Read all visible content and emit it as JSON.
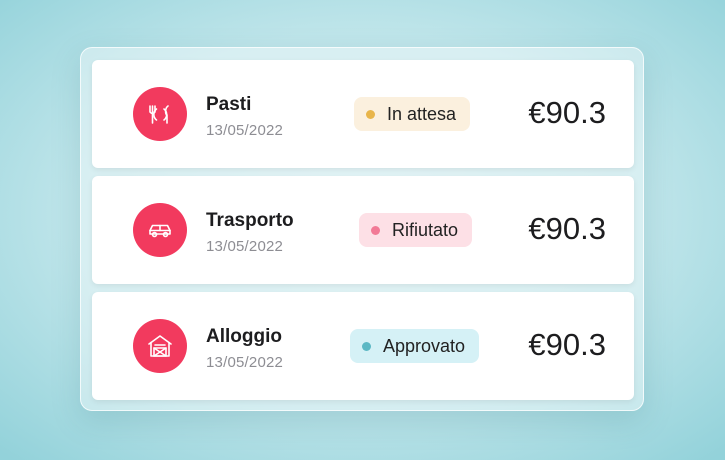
{
  "expenses": [
    {
      "title": "Pasti",
      "date": "13/05/2022",
      "status": "In attesa",
      "amount": "€90.3",
      "icon": "plate-cutlery-icon",
      "status_bg": "#fbf0de",
      "status_dot": "#e8b54a"
    },
    {
      "title": "Trasporto",
      "date": "13/05/2022",
      "status": "Rifiutato",
      "amount": "€90.3",
      "icon": "car-icon",
      "status_bg": "#fde0e6",
      "status_dot": "#f27a96"
    },
    {
      "title": "Alloggio",
      "date": "13/05/2022",
      "status": "Approvato",
      "amount": "€90.3",
      "icon": "barn-icon",
      "status_bg": "#d5f1f6",
      "status_dot": "#5cb8c4"
    }
  ],
  "colors": {
    "icon_circle": "#f23a5e"
  }
}
